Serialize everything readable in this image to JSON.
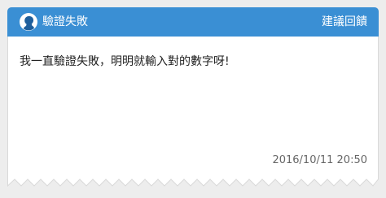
{
  "post": {
    "title": "驗證失敗",
    "feedback_label": "建議回饋",
    "message": "我一直驗證失敗，明明就輸入對的數字呀!",
    "timestamp": "2016/10/11 20:50"
  },
  "avatar": {
    "icon": "person-silhouette-icon",
    "bg_color": "#ffffff",
    "fg_color": "#1f5f9c"
  },
  "colors": {
    "header": "#3a8fd4",
    "card": "#ffffff",
    "background": "#ededed"
  }
}
